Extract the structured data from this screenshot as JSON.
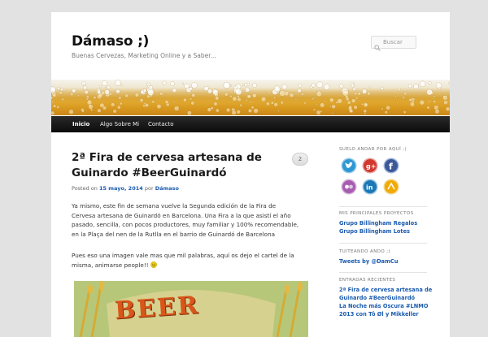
{
  "site": {
    "title": "Dámaso ;)",
    "description": "Buenas Cervezas, Marketing Online y a Saber..."
  },
  "search": {
    "placeholder": "Buscar"
  },
  "nav": {
    "items": [
      {
        "label": "Inicio",
        "active": true
      },
      {
        "label": "Algo Sobre Mi",
        "active": false
      },
      {
        "label": "Contacto",
        "active": false
      }
    ]
  },
  "post": {
    "title": "2ª Fira de cervesa artesana de Guinardo #BeerGuinardó",
    "comment_count": "2",
    "meta_prefix": "Posted on",
    "date": "15 mayo, 2014",
    "meta_by": "por",
    "author": "Dámaso",
    "paragraph1": "Ya mismo, este fin de semana vuelve la Segunda edición de la Fira de Cervesa artesana de Guinardó en Barcelona. Una Fira a la que asistí el año pasado, sencilla, con pocos productores, muy familiar y 100% recomendable, en la Plaça del nen de la Rutlla en el barrio de Guinardó de Barcelona",
    "paragraph2": "Pues eso una imagen vale mas que mil palabras, aquí os dejo el cartel de la misma, animarse people!!",
    "poster_text": "BEER"
  },
  "sidebar": {
    "social_heading": "SUELO ANDAR POR AQUÍ ;)",
    "social_icons": [
      "twitter-icon",
      "google-plus-icon",
      "facebook-icon",
      "flickr-icon",
      "linkedin-icon",
      "rss-icon"
    ],
    "projects_heading": "MIS PRINCIPALES PROYECTOS",
    "projects": [
      "Grupo Billingham Regalos",
      "Grupo Billingham Lotes"
    ],
    "tweets_heading": "TUITEANDO ANDO ;)",
    "tweets_link": "Tweets by @DamCu",
    "recent_heading": "ENTRADAS RECIENTES",
    "recent": [
      "2ª Fira de cervesa artesana de Guinardo #BeerGuinardó",
      "La Noche más Oscura #LNMO 2013 con Tô Øl y Mikkeller"
    ]
  },
  "colors": {
    "link": "#1b5bb0",
    "nav_bg": "#1a1a1a",
    "page_bg": "#e2e2e2"
  }
}
